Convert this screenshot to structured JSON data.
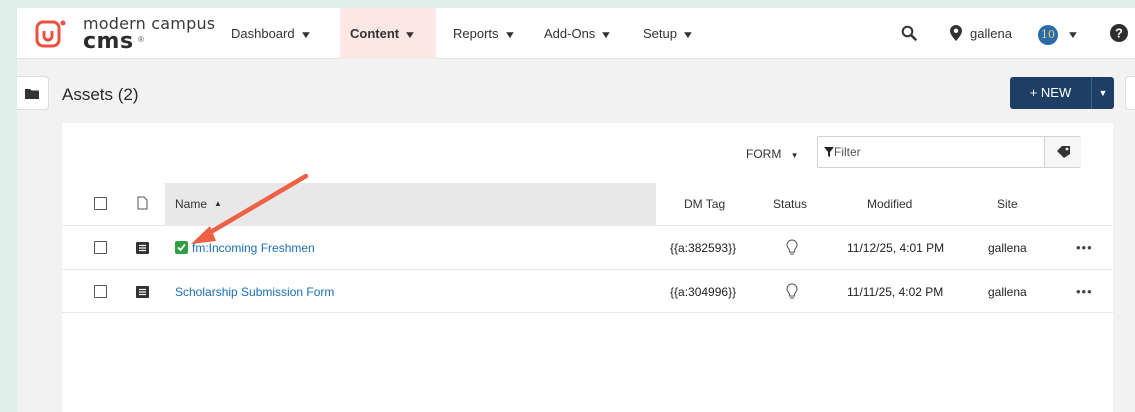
{
  "brand": {
    "line1": "modern campus",
    "line2": "cms",
    "reg": "®",
    "color": "#e9523f"
  },
  "nav": {
    "items": [
      {
        "label": "Dashboard",
        "active": false
      },
      {
        "label": "Content",
        "active": true
      },
      {
        "label": "Reports",
        "active": false
      },
      {
        "label": "Add-Ons",
        "active": false
      },
      {
        "label": "Setup",
        "active": false
      }
    ],
    "user": "gallena",
    "badge": "10"
  },
  "page": {
    "title": "Assets (2)"
  },
  "new_button": {
    "label": "+ NEW"
  },
  "toolbar": {
    "type_filter": "FORM",
    "filter_placeholder": "Filter"
  },
  "table": {
    "headers": {
      "name": "Name",
      "dm_tag": "DM Tag",
      "status": "Status",
      "modified": "Modified",
      "site": "Site"
    },
    "rows": [
      {
        "name": "fm:Incoming Freshmen",
        "dm_tag": "{{a:382593}}",
        "modified": "11/12/25, 4:01 PM",
        "site": "gallena",
        "checked_in": true
      },
      {
        "name": "Scholarship Submission Form",
        "dm_tag": "{{a:304996}}",
        "modified": "11/11/25, 4:02 PM",
        "site": "gallena",
        "checked_in": false
      }
    ]
  },
  "colors": {
    "accent": "#e9523f",
    "primary": "#1d3f66",
    "link": "#1a6fb3",
    "annotation_arrow": "#ee6145"
  }
}
